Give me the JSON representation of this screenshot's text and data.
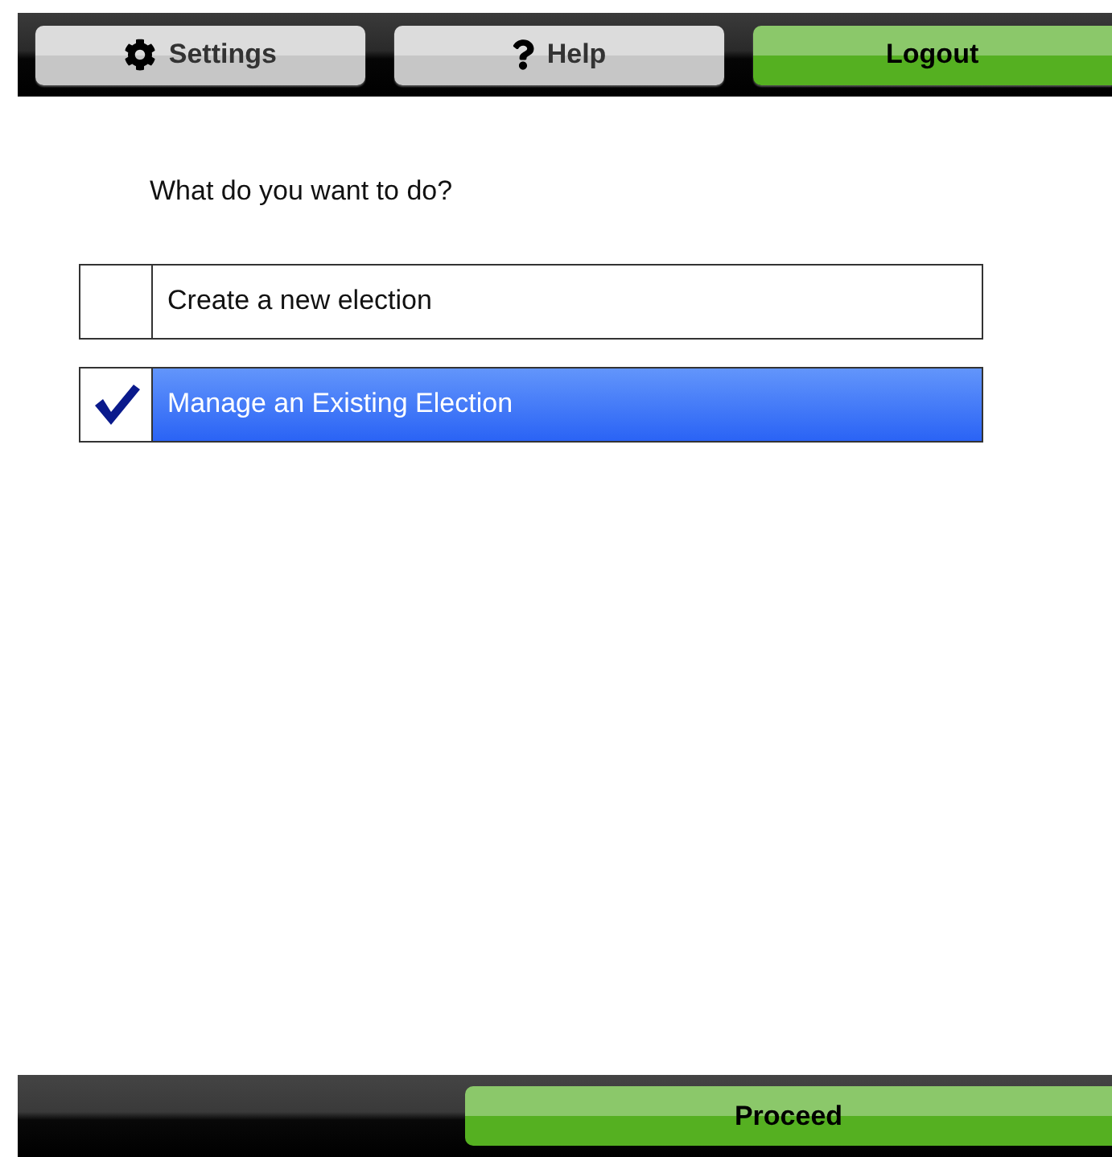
{
  "toolbar": {
    "buttons": [
      {
        "label": "Settings",
        "kind": "settings"
      },
      {
        "label": "Help",
        "kind": "help"
      },
      {
        "label": "Logout",
        "kind": "logout"
      }
    ]
  },
  "question": "What do you want to do?",
  "options": [
    {
      "label": "Create a new election",
      "selected": false
    },
    {
      "label": "Manage an Existing Election",
      "selected": true
    }
  ],
  "footer": {
    "button": "Proceed"
  }
}
